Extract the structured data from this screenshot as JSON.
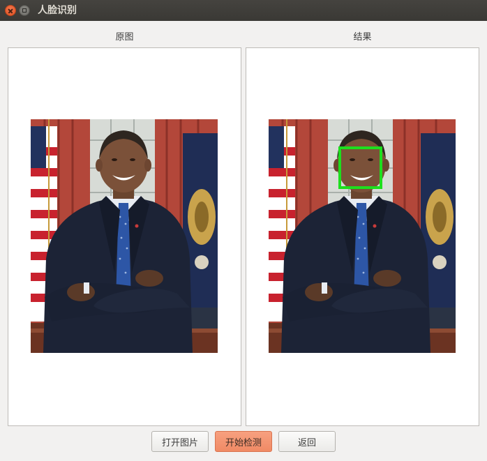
{
  "window": {
    "title": "人脸识别"
  },
  "panels": {
    "original_label": "原图",
    "result_label": "结果"
  },
  "buttons": {
    "open_image": "打开图片",
    "start_detect": "开始检测",
    "back": "返回"
  },
  "colors": {
    "detection_box": "#1ddf1d",
    "primary_button": "#f08a65"
  }
}
